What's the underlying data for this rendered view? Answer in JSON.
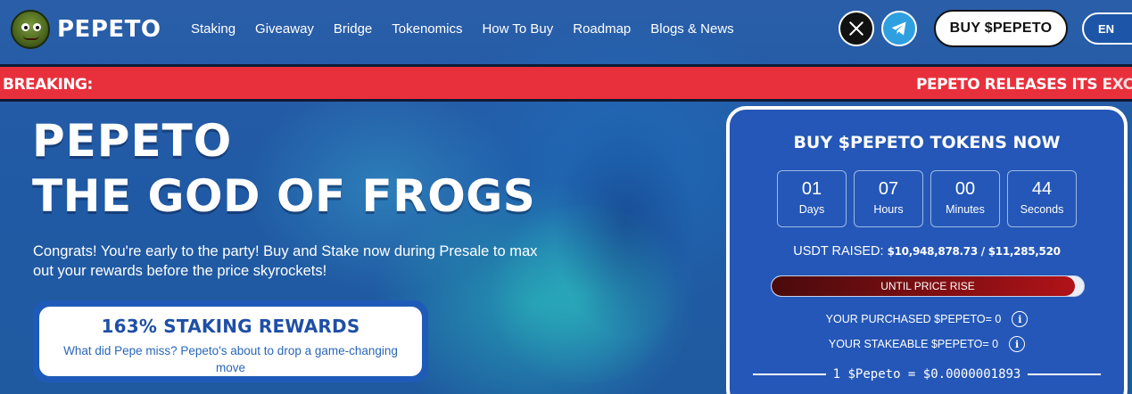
{
  "header": {
    "brand": "PEPETO",
    "nav": [
      "Staking",
      "Giveaway",
      "Bridge",
      "Tokenomics",
      "How To Buy",
      "Roadmap",
      "Blogs & News"
    ],
    "buy_label": "BUY $PEPETO",
    "language": "EN"
  },
  "ticker": {
    "label": "BREAKING:",
    "message": "PEPETO RELEASES ITS EXCHA"
  },
  "hero": {
    "title_line1": "PEPETO",
    "title_line2": "THE GOD OF FROGS",
    "description": "Congrats! You're early to the party! Buy and Stake now during Presale to max out your rewards before the price skyrockets!",
    "staking_title": "163% STAKING REWARDS",
    "staking_subtitle": "What did Pepe miss? Pepeto's about to drop a game-changing move"
  },
  "presale": {
    "title": "BUY $PEPETO TOKENS NOW",
    "countdown": [
      {
        "value": "01",
        "label": "Days"
      },
      {
        "value": "07",
        "label": "Hours"
      },
      {
        "value": "00",
        "label": "Minutes"
      },
      {
        "value": "44",
        "label": "Seconds"
      }
    ],
    "raised_label": "USDT RAISED:",
    "raised_value": "$10,948,878.73 / $11,285,520",
    "progress_fraction": 0.97,
    "progress_label": "UNTIL PRICE RISE",
    "purchased": "YOUR PURCHASED $PEPETO= 0",
    "stakeable": "YOUR STAKEABLE $PEPETO= 0",
    "rate": "1 $Pepeto = $0.0000001893"
  },
  "colors": {
    "ticker_bg": "#e8303c",
    "panel_bg": "#2457b7",
    "staking_text": "#1f4fa6"
  },
  "icons": [
    "x-icon",
    "telegram-icon",
    "info-icon"
  ]
}
